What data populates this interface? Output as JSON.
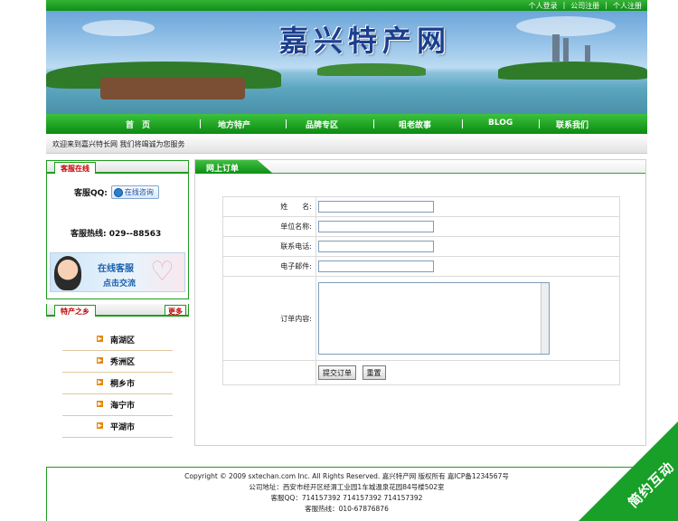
{
  "top_links": [
    "个人登录",
    "公司注册",
    "个人注册"
  ],
  "banner": {
    "site_title": "嘉兴特产网"
  },
  "nav": [
    "首　页",
    "地方特产",
    "品牌专区",
    "咀老故事",
    "BLOG",
    "联系我们"
  ],
  "welcome": "欢迎来到嘉兴特长网 我们将竭诚为您服务",
  "service_box": {
    "tab": "客服在线",
    "qq_label": "客服QQ:",
    "qq_button": "在线咨询",
    "hotline": "客服热线: 029--88563",
    "online_banner_title": "在线客服",
    "online_banner_sub": "点击交流"
  },
  "region_box": {
    "tab": "特产之乡",
    "more": "更多",
    "items": [
      "南湖区",
      "秀洲区",
      "桐乡市",
      "海宁市",
      "平湖市"
    ]
  },
  "order": {
    "tab": "网上订单",
    "fields": [
      {
        "label": "姓　　名:",
        "value": ""
      },
      {
        "label": "单位名称:",
        "value": ""
      },
      {
        "label": "联系电话:",
        "value": ""
      },
      {
        "label": "电子邮件:",
        "value": ""
      }
    ],
    "content_label": "订单内容:",
    "submit": "提交订单",
    "reset": "重置"
  },
  "footer": [
    "Copyright © 2009 sxtechan.com Inc. All Rights Reserved. 嘉兴特产网 版权所有 嘉ICP备1234567号",
    "公司地址：西安市经开区经渭工业园1车城温泉花园84号楼502室",
    "客服QQ：714157392 714157392 714157392",
    "客服热线：010-67876876"
  ],
  "watermark": "简约互动"
}
